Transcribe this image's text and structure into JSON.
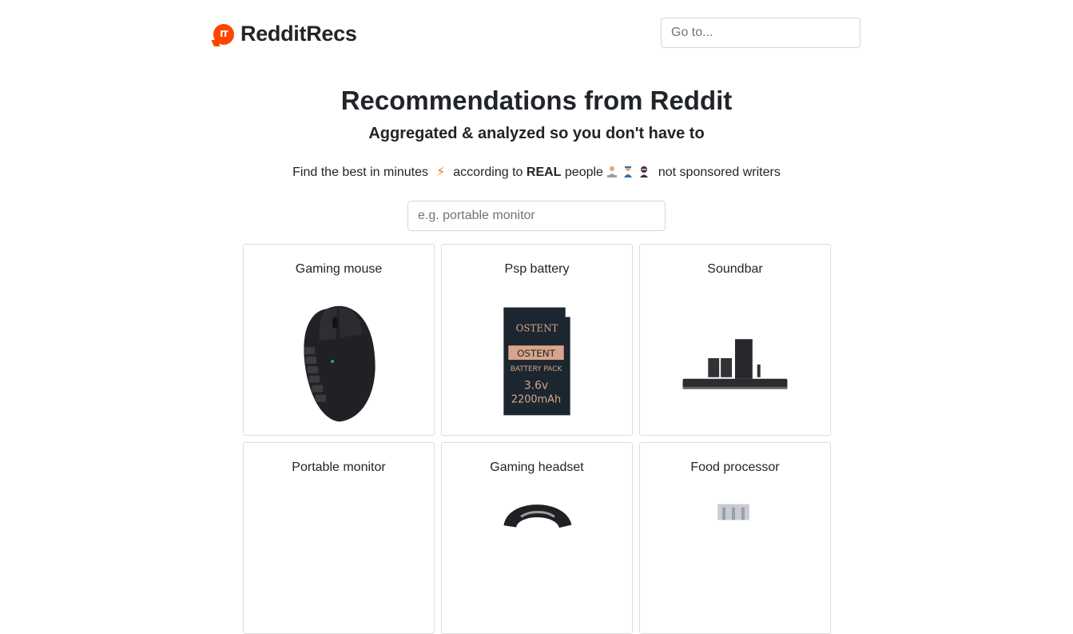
{
  "brand": {
    "logo_glyph": "rr",
    "name": "RedditRecs",
    "color": "#ff4500"
  },
  "goto": {
    "placeholder": "Go to..."
  },
  "hero": {
    "title": "Recommendations from Reddit",
    "subtitle": "Aggregated & analyzed so you don't have to"
  },
  "tagline": {
    "part1": "Find the best in minutes",
    "bolt_icon": "⚡",
    "part2": "according to",
    "emphasis": "REAL",
    "part3": "people",
    "part4": "not sponsored writers"
  },
  "search": {
    "placeholder": "e.g. portable monitor"
  },
  "categories": [
    {
      "label": "Gaming mouse",
      "icon": "gaming-mouse-image"
    },
    {
      "label": "Psp battery",
      "icon": "psp-battery-image",
      "image_text": [
        "OSTENT",
        "OSTENT",
        "BATTERY PACK",
        "3.6v",
        "2200mAh"
      ]
    },
    {
      "label": "Soundbar",
      "icon": "soundbar-image"
    },
    {
      "label": "Portable monitor",
      "icon": "portable-monitor-image"
    },
    {
      "label": "Gaming headset",
      "icon": "gaming-headset-image"
    },
    {
      "label": "Food processor",
      "icon": "food-processor-image"
    }
  ]
}
